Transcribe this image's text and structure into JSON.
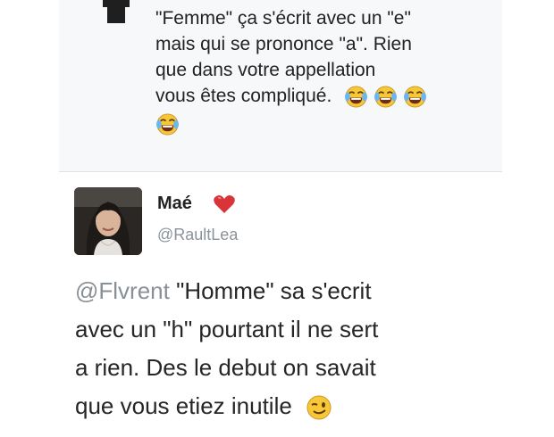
{
  "quoted_tweet": {
    "lines": [
      "\"Femme\" ça s'écrit avec un \"e\"",
      "mais qui se prononce \"a\". Rien",
      "que dans votre appellation",
      "vous êtes compliqué."
    ],
    "emoji_line1_count": 3,
    "emoji_line2_count": 1,
    "emoji_icon": "tears-of-joy-icon"
  },
  "tweet": {
    "author_name": "Maé",
    "author_badge_icon": "red-heart-icon",
    "author_handle": "@RaultLea",
    "mention": "@Flvrent",
    "body_line1_rest": " \"Homme\" sa s'ecrit",
    "body_line2": "avec un \"h\" pourtant il ne sert",
    "body_line3": "a rien. Des le debut on savait",
    "body_line4": "que vous etiez inutile",
    "end_emoji_icon": "winking-face-icon"
  },
  "colors": {
    "heart": "#d8343a",
    "emoji_face": "#f7c735",
    "mention": "#888f96",
    "handle": "#8a939b",
    "quoted_bg": "#f6f8f9"
  }
}
